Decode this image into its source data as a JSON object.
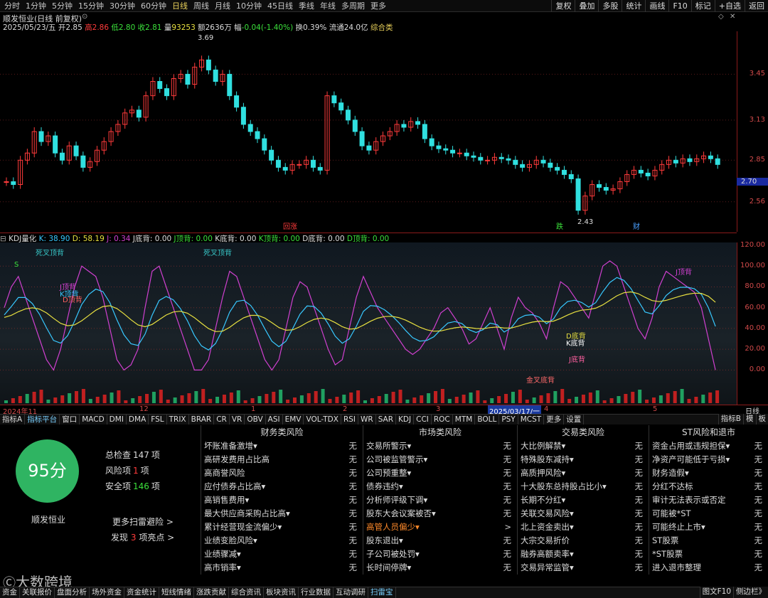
{
  "period_tabs": [
    {
      "label": "分时"
    },
    {
      "label": "1分钟"
    },
    {
      "label": "5分钟"
    },
    {
      "label": "15分钟"
    },
    {
      "label": "30分钟"
    },
    {
      "label": "60分钟"
    },
    {
      "label": "日线",
      "active": true
    },
    {
      "label": "周线"
    },
    {
      "label": "月线"
    },
    {
      "label": "10分钟"
    },
    {
      "label": "45日线"
    },
    {
      "label": "季线"
    },
    {
      "label": "年线"
    },
    {
      "label": "多周期"
    },
    {
      "label": "更多"
    }
  ],
  "right_tools": [
    "复权",
    "叠加",
    "多股",
    "统计",
    "画线",
    "F10",
    "标记",
    "+自选",
    "返回"
  ],
  "stock": {
    "name": "顺发恒业(日线 前复权)",
    "date": "2025/05/23/五",
    "open_label": "开",
    "open": "2.85",
    "high_label": "高",
    "high": "2.86",
    "low_label": "低",
    "low": "2.80",
    "close_label": "收",
    "close": "2.81",
    "vol_label": "量",
    "vol": "93253",
    "amt_label": "额",
    "amt": "2636万",
    "chg_label": "幅",
    "chg": "-0.04(-1.40%)",
    "turn_label": "换",
    "turn": "0.39%",
    "float_label": "流通",
    "float": "24.0亿",
    "category": "综合类"
  },
  "price_axis": {
    "ticks": [
      "3.45",
      "3.13",
      "2.85",
      "2.56"
    ],
    "current": "2.70"
  },
  "price_annotations": {
    "high_label": "3.69",
    "low_label": "2.43",
    "tag_1": "回涨",
    "tag_2": "跌",
    "tag_3": "财"
  },
  "kdj_header": {
    "name": "KDJ量化",
    "k": "K: 38.90",
    "d": "D: 58.19",
    "j": "J: 0.34",
    "items": [
      "J底背: 0.00",
      "J顶背: 0.00",
      "K底背: 0.00",
      "K顶背: 0.00",
      "D底背: 0.00",
      "D顶背: 0.00"
    ]
  },
  "kdj_axis": [
    "120.00",
    "100.00",
    "80.00",
    "60.00",
    "40.00",
    "20.00",
    "0.00"
  ],
  "kdj_annotations": {
    "dead_cross_1": "死叉顶背",
    "dead_cross_2": "死叉顶背",
    "golden_cross": "金叉底背",
    "j_top": "J顶背",
    "k_top": "K顶背",
    "d_top": "D顶背",
    "d_bottom": "D底背",
    "k_bottom": "K底背",
    "j_bottom": "J底背",
    "s": "S"
  },
  "date_axis": {
    "year": "2024年11",
    "months": [
      "12",
      "1",
      "2",
      "3",
      "4",
      "5"
    ],
    "highlight": "2025/03/17/一",
    "period": "日线"
  },
  "indicator_tabs": [
    "指标A",
    "指标平台",
    "窗口",
    "MACD",
    "DMI",
    "DMA",
    "FSL",
    "TRIX",
    "BRAR",
    "CR",
    "VR",
    "OBV",
    "ASI",
    "EMV",
    "VOL-TDX",
    "RSI",
    "WR",
    "SAR",
    "KDJ",
    "CCI",
    "ROC",
    "MTM",
    "BOLL",
    "PSY",
    "MCST",
    "更多",
    "设置"
  ],
  "indicator_right": [
    "指标B",
    "模",
    "板"
  ],
  "risk": {
    "score": "95分",
    "stock_name": "顺发恒业",
    "total_label": "总检查",
    "total": "147",
    "total_unit": "项",
    "risk_label": "风险项",
    "risk": "1",
    "risk_unit": "项",
    "safe_label": "安全项",
    "safe": "146",
    "safe_unit": "项",
    "more_scan": "更多扫雷避险 >",
    "find_pre": "发现",
    "find_num": "3",
    "find_post": "项亮点 >",
    "columns": [
      {
        "title": "财务类风险",
        "rows": [
          {
            "label": "坏账准备激增▾",
            "value": "无"
          },
          {
            "label": "高研发费用占比高",
            "value": "无"
          },
          {
            "label": "高商誉风险",
            "value": "无"
          },
          {
            "label": "应付债券占比高▾",
            "value": "无"
          },
          {
            "label": "高销售费用▾",
            "value": "无"
          },
          {
            "label": "最大供应商采购占比高▾",
            "value": "无"
          },
          {
            "label": "累计经营现金流偏少▾",
            "value": "无"
          },
          {
            "label": "业绩变脸风险▾",
            "value": "无"
          },
          {
            "label": "业绩骤减▾",
            "value": "无"
          },
          {
            "label": "高市销率▾",
            "value": "无"
          }
        ]
      },
      {
        "title": "市场类风险",
        "rows": [
          {
            "label": "交易所警示▾",
            "value": "无"
          },
          {
            "label": "公司被监管警示▾",
            "value": "无"
          },
          {
            "label": "公司预重整▾",
            "value": "无"
          },
          {
            "label": "债券违约▾",
            "value": "无"
          },
          {
            "label": "分析师评级下调▾",
            "value": "无"
          },
          {
            "label": "股东大会议案被否▾",
            "value": "无"
          },
          {
            "label": "高管人员偏少▾",
            "value": ">",
            "warn": true
          },
          {
            "label": "股东退出▾",
            "value": "无"
          },
          {
            "label": "子公司被处罚▾",
            "value": "无"
          },
          {
            "label": "长时间停牌▾",
            "value": "无"
          }
        ]
      },
      {
        "title": "交易类风险",
        "rows": [
          {
            "label": "大比例解禁▾",
            "value": "无"
          },
          {
            "label": "特殊股东减持▾",
            "value": "无"
          },
          {
            "label": "高质押风险▾",
            "value": "无"
          },
          {
            "label": "十大股东总持股占比小▾",
            "value": "无"
          },
          {
            "label": "长期不分红▾",
            "value": "无"
          },
          {
            "label": "关联交易风险▾",
            "value": "无"
          },
          {
            "label": "北上资金卖出▾",
            "value": "无"
          },
          {
            "label": "大宗交易折价",
            "value": "无"
          },
          {
            "label": "融券高额卖率▾",
            "value": "无"
          },
          {
            "label": "交易异常监管▾",
            "value": "无"
          }
        ]
      },
      {
        "title": "ST风险和退市",
        "rows": [
          {
            "label": "资金占用或违规担保▾",
            "value": "无"
          },
          {
            "label": "净资产可能低于亏损▾",
            "value": "无"
          },
          {
            "label": "财务造假▾",
            "value": "无"
          },
          {
            "label": "分红不达标",
            "value": "无"
          },
          {
            "label": "审计无法表示或否定",
            "value": "无"
          },
          {
            "label": "可能被*ST",
            "value": "无"
          },
          {
            "label": "可能终止上市▾",
            "value": "无"
          },
          {
            "label": "ST股票",
            "value": "无"
          },
          {
            "label": "*ST股票",
            "value": "无"
          },
          {
            "label": "进入退市整理",
            "value": "无"
          }
        ]
      }
    ]
  },
  "watermark": "大数跨境",
  "bottom_tabs": [
    "资金",
    "关联报价",
    "盘面分析",
    "场外资金",
    "资金统计",
    "短线情绪",
    "涨跌贡献",
    "综合资讯",
    "板块资讯",
    "行业数据",
    "互动调研",
    "扫雷宝"
  ],
  "bottom_right": [
    "图文F10",
    "侧边栏》"
  ],
  "colors": {
    "up": "#ff3b3b",
    "down": "#30e0e0",
    "k_line": "#38c8ff",
    "d_line": "#e8e040",
    "j_line": "#d040d0",
    "score": "#2fb462",
    "axis": "#d24a4a"
  }
}
